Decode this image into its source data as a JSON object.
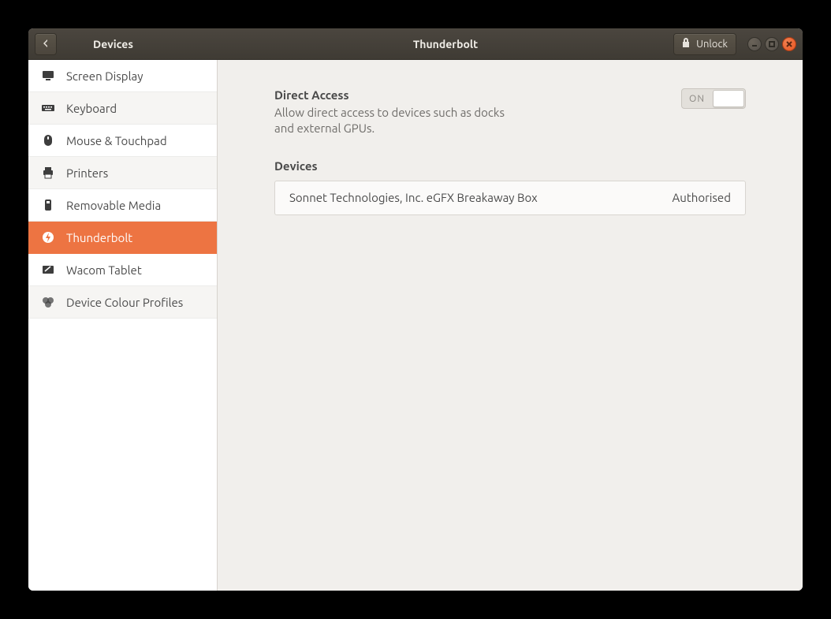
{
  "header": {
    "sidebar_title": "Devices",
    "page_title": "Thunderbolt",
    "unlock_label": "Unlock"
  },
  "sidebar": {
    "items": [
      {
        "label": "Screen Display"
      },
      {
        "label": "Keyboard"
      },
      {
        "label": "Mouse & Touchpad"
      },
      {
        "label": "Printers"
      },
      {
        "label": "Removable Media"
      },
      {
        "label": "Thunderbolt"
      },
      {
        "label": "Wacom Tablet"
      },
      {
        "label": "Device Colour Profiles"
      }
    ],
    "active_index": 5
  },
  "content": {
    "direct_access": {
      "title": "Direct Access",
      "description": "Allow direct access to devices such as docks and external GPUs.",
      "switch_label": "ON",
      "switch_on": true
    },
    "devices": {
      "heading": "Devices",
      "list": [
        {
          "name": "Sonnet Technologies, Inc. eGFX Breakaway Box",
          "status": "Authorised"
        }
      ]
    }
  }
}
